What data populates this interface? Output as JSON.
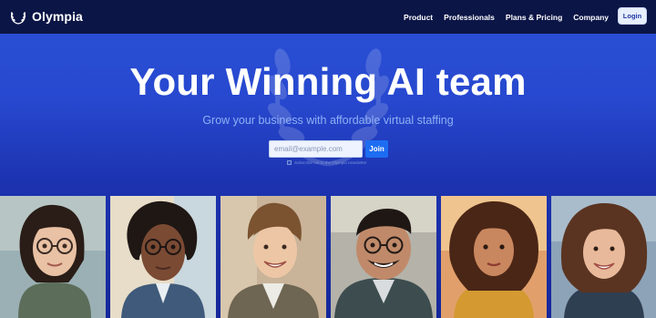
{
  "nav": {
    "brand": "Olympia",
    "links": [
      "Product",
      "Professionals",
      "Plans & Pricing",
      "Company"
    ],
    "login_label": "Login"
  },
  "hero": {
    "title": "Your Winning AI team",
    "subtitle": "Grow your business with affordable virtual staffing",
    "email_placeholder": "email@example.com",
    "join_label": "Join",
    "consent_text": "Subscribe me to the Olympia newsletter"
  },
  "colors": {
    "nav_bg": "#0b1546",
    "hero_bg": "#2748cf",
    "join_button": "#1d6df2",
    "subtitle": "#8fb0f5"
  },
  "gallery": {
    "portraits": [
      "woman-with-glasses-portrait",
      "woman-with-glasses-in-suit-portrait",
      "smiling-young-man-portrait",
      "man-with-glasses-portrait",
      "curly-haired-woman-portrait",
      "smiling-woman-portrait"
    ]
  }
}
